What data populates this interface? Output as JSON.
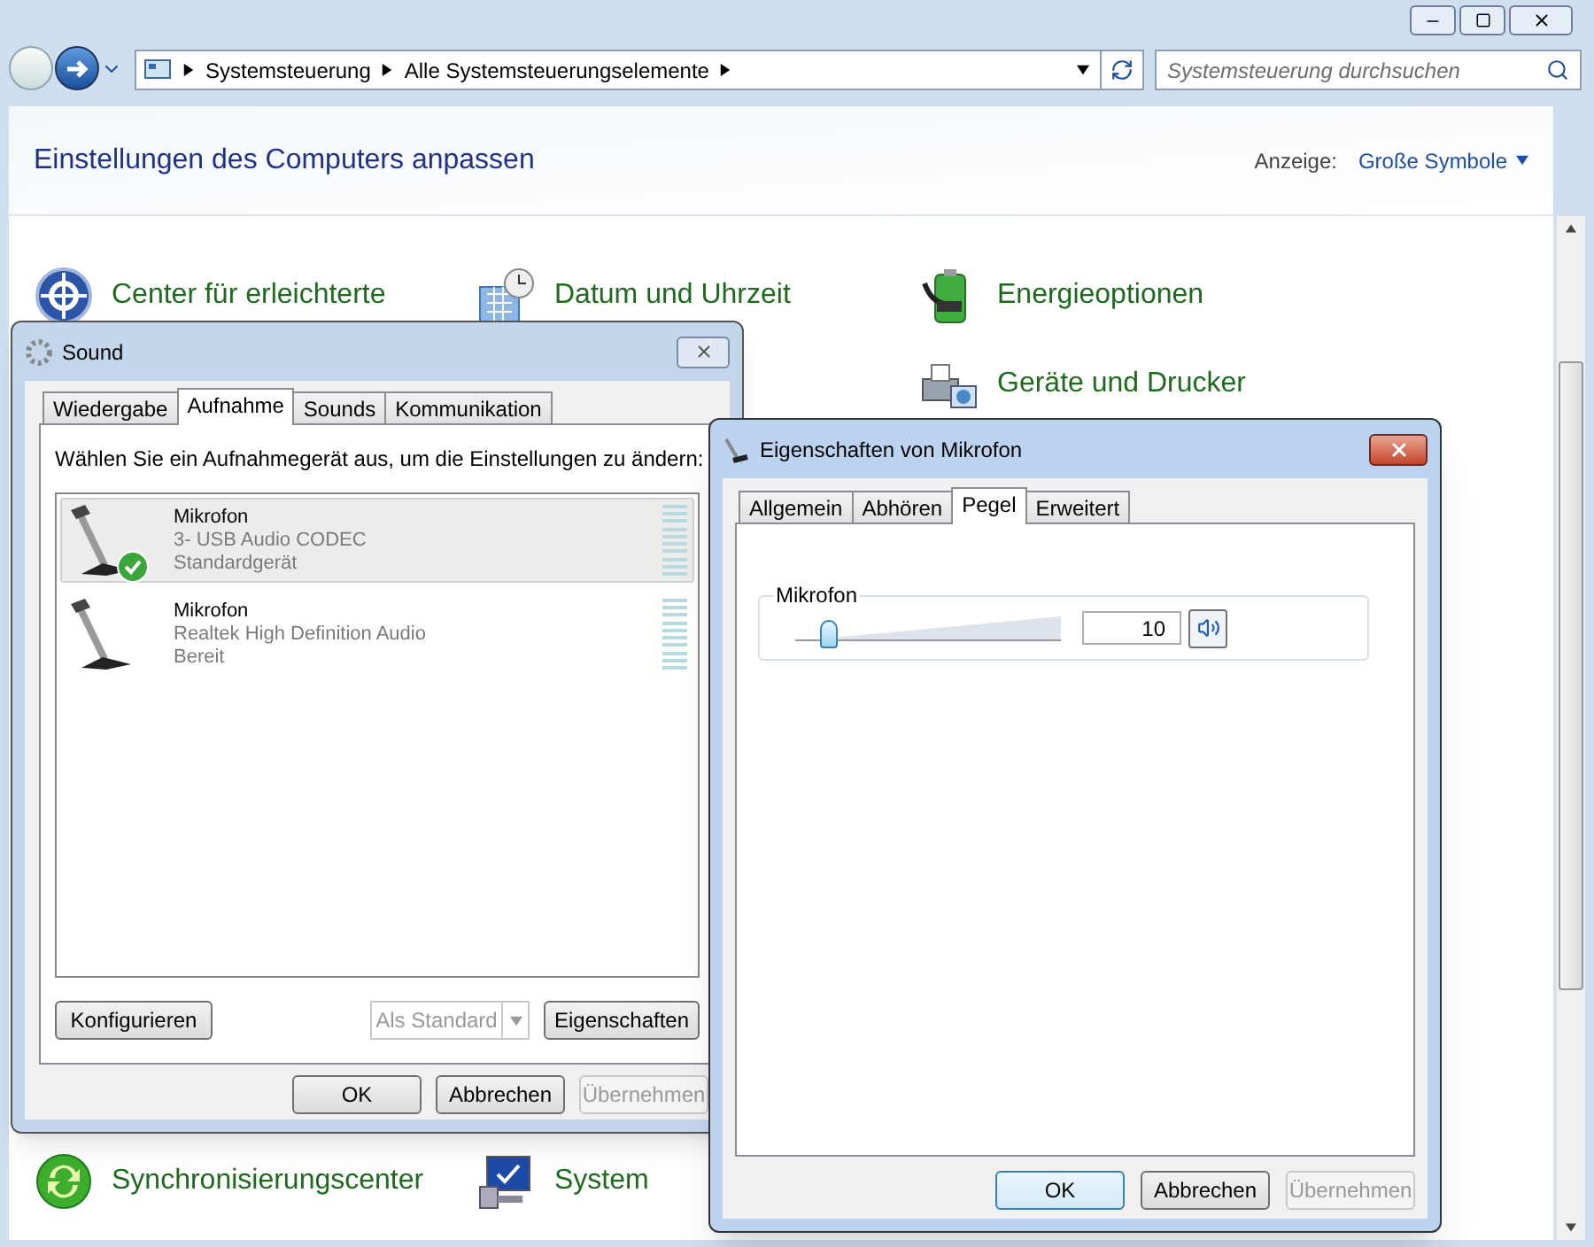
{
  "explorer": {
    "breadcrumbs": [
      "Systemsteuerung",
      "Alle Systemsteuerungselemente"
    ],
    "search": {
      "placeholder": "Systemsteuerung durchsuchen"
    },
    "heading": "Einstellungen des Computers anpassen",
    "view_label": "Anzeige:",
    "view_value": "Große Symbole",
    "items": [
      {
        "label": "Center für erleichterte",
        "kind": "accessibility"
      },
      {
        "label": "Datum und Uhrzeit",
        "kind": "clock"
      },
      {
        "label": "Energieoptionen",
        "kind": "battery"
      },
      {
        "label": "Geräte und Drucker",
        "kind": "printer"
      },
      {
        "label": "Synchronisierungscenter",
        "kind": "sync"
      },
      {
        "label": "System",
        "kind": "computer"
      }
    ]
  },
  "sound": {
    "title": "Sound",
    "tabs": [
      {
        "label": "Wiedergabe",
        "selected": false
      },
      {
        "label": "Aufnahme",
        "selected": true
      },
      {
        "label": "Sounds",
        "selected": false
      },
      {
        "label": "Kommunikation",
        "selected": false
      }
    ],
    "instruction": "Wählen Sie ein Aufnahmegerät aus, um die Einstellungen zu ändern:",
    "devices": [
      {
        "name": "Mikrofon",
        "driver": "3- USB Audio CODEC",
        "status": "Standardgerät",
        "default": true,
        "selected": true
      },
      {
        "name": "Mikrofon",
        "driver": "Realtek High Definition Audio",
        "status": "Bereit",
        "default": false,
        "selected": false
      }
    ],
    "configure_button": {
      "label": "Konfigurieren",
      "disabled": false
    },
    "default_button": {
      "label": "Als Standard",
      "disabled": true
    },
    "properties_button": {
      "label": "Eigenschaften",
      "disabled": false
    },
    "buttons": [
      {
        "label": "OK",
        "disabled": false
      },
      {
        "label": "Abbrechen",
        "disabled": false
      },
      {
        "label": "Übernehmen",
        "disabled": true
      }
    ]
  },
  "properties": {
    "title": "Eigenschaften von Mikrofon",
    "tabs": [
      {
        "label": "Allgemein",
        "selected": false
      },
      {
        "label": "Abhören",
        "selected": false
      },
      {
        "label": "Pegel",
        "selected": true
      },
      {
        "label": "Erweitert",
        "selected": false
      }
    ],
    "group_label": "Mikrofon",
    "level": 0.1,
    "value": "10",
    "buttons": [
      {
        "label": "OK",
        "disabled": false
      },
      {
        "label": "Abbrechen",
        "disabled": false
      },
      {
        "label": "Übernehmen",
        "disabled": true
      }
    ]
  }
}
